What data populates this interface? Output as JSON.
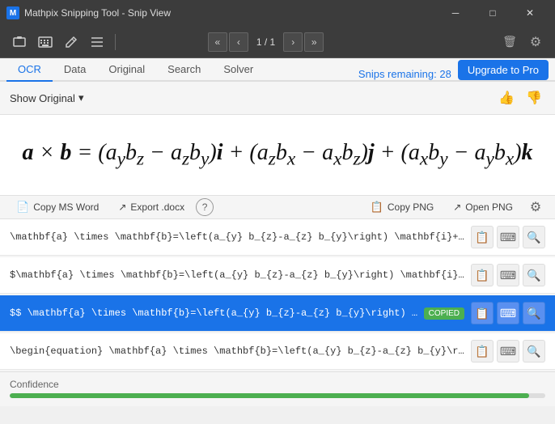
{
  "titlebar": {
    "title": "Mathpix Snipping Tool - Snip View",
    "icon_label": "M",
    "minimize_label": "─",
    "maximize_label": "□",
    "close_label": "✕"
  },
  "toolbar": {
    "screenshot_icon": "⊞",
    "keyboard_icon": "⌨",
    "pen_icon": "✏",
    "menu_icon": "≡",
    "nav_prev_prev": "«",
    "nav_prev": "‹",
    "nav_page": "1 / 1",
    "nav_next": "›",
    "nav_next_next": "»",
    "trash_icon": "🗑",
    "settings_icon": "⚙"
  },
  "tabs": {
    "items": [
      {
        "label": "OCR",
        "active": true
      },
      {
        "label": "Data",
        "active": false
      },
      {
        "label": "Original",
        "active": false
      },
      {
        "label": "Search",
        "active": false
      },
      {
        "label": "Solver",
        "active": false
      }
    ],
    "snips_remaining_label": "Snips remaining: 28",
    "upgrade_label": "Upgrade to Pro"
  },
  "show_original": {
    "label": "Show Original",
    "dropdown_icon": "▾",
    "thumbup_icon": "👍",
    "thumbdown_icon": "👎"
  },
  "math_formula": {
    "display": "a × b = (a꜀b_z − a_z b_y)i + (a_z b_x − a_x b_z)j + (a_x b_y − a_y b_x)k"
  },
  "action_bar": {
    "copy_msword_icon": "📄",
    "copy_msword_label": "Copy MS Word",
    "export_docx_icon": "↗",
    "export_docx_label": "Export .docx",
    "help_icon": "?",
    "copy_png_icon": "📋",
    "copy_png_label": "Copy PNG",
    "open_png_icon": "↗",
    "open_png_label": "Open PNG",
    "settings_icon": "⚙"
  },
  "latex_rows": [
    {
      "text": "\\mathbf{a} \\times \\mathbf{b}=\\left(a_{y} b_{z}-a_{z} b_{y}\\right) \\mathbf{i}+\\left(a_",
      "selected": false,
      "copied": false
    },
    {
      "text": "$\\mathbf{a} \\times \\mathbf{b}=\\left(a_{y} b_{z}-a_{z} b_{y}\\right) \\mathbf{i}+\\left(a",
      "selected": false,
      "copied": false
    },
    {
      "text": "$$ \\mathbf{a} \\times \\mathbf{b}=\\left(a_{y} b_{z}-a_{z} b_{y}\\right) \\mathbf{",
      "selected": true,
      "copied": true
    },
    {
      "text": "\\begin{equation}  \\mathbf{a} \\times \\mathbf{b}=\\left(a_{y} b_{z}-a_{z} b_{y}\\right) \\",
      "selected": false,
      "copied": false
    }
  ],
  "copied_badge_label": "COPIED",
  "confidence": {
    "label": "Confidence",
    "percent": 97
  },
  "row_icons": {
    "clipboard_icon": "📋",
    "keyboard_icon": "⌨",
    "search_icon": "🔍"
  }
}
